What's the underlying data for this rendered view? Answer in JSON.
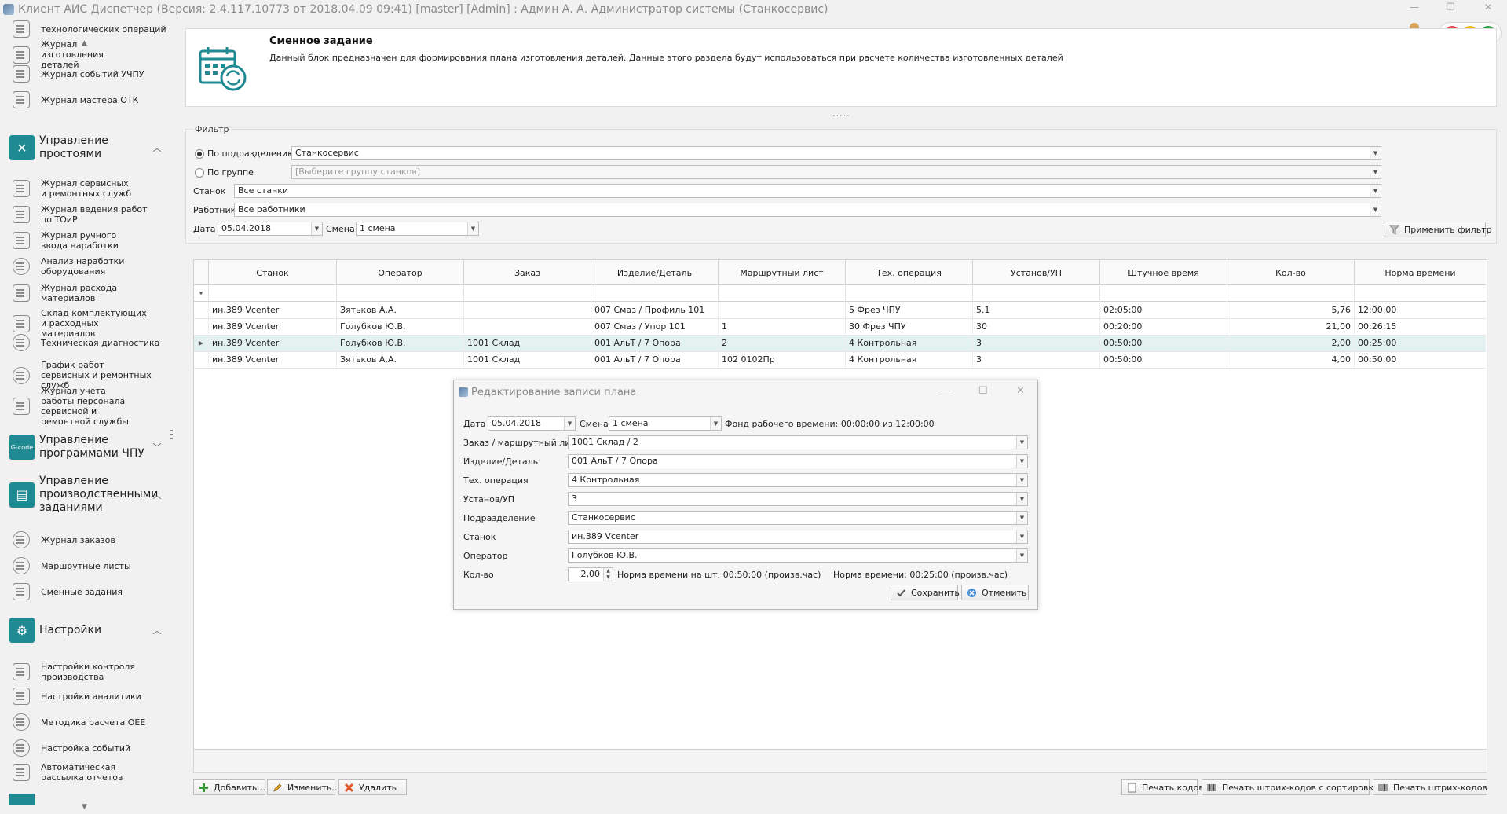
{
  "window": {
    "title": "Клиент АИС Диспетчер (Версия: 2.4.117.10773 от 2018.04.09 09:41) [master]  [Admin] : Админ А. А. Администратор системы (Станкосервис)"
  },
  "sidebar": {
    "items_top": [
      {
        "label": "технологических операций"
      },
      {
        "label": "Журнал изготовления деталей"
      },
      {
        "label": "Журнал событий УЧПУ"
      },
      {
        "label": "Журнал мастера ОТК"
      }
    ],
    "group_downtime": {
      "label": "Управление простоями"
    },
    "items_downtime": [
      {
        "label": "Журнал сервисных и ремонтных служб"
      },
      {
        "label": "Журнал ведения работ по ТОиР"
      },
      {
        "label": "Журнал ручного ввода наработки"
      },
      {
        "label": "Анализ наработки оборудования"
      },
      {
        "label": "Журнал расхода материалов"
      },
      {
        "label": "Склад комплектующих и расходных материалов"
      },
      {
        "label": "Техническая диагностика"
      },
      {
        "label": "График работ сервисных и ремонтных служб"
      },
      {
        "label": "Журнал учета работы персонала сервисной и ремонтной службы"
      }
    ],
    "group_cnc": {
      "label": "Управление программами ЧПУ",
      "icon_text": "G-code"
    },
    "group_production": {
      "label": "Управление производственными заданиями"
    },
    "items_production": [
      {
        "label": "Журнал заказов"
      },
      {
        "label": "Маршрутные листы"
      },
      {
        "label": "Сменные задания"
      }
    ],
    "group_settings": {
      "label": "Настройки"
    },
    "items_settings": [
      {
        "label": "Настройки контроля производства"
      },
      {
        "label": "Настройки аналитики"
      },
      {
        "label": "Методика расчета OEE"
      },
      {
        "label": "Настройка событий"
      },
      {
        "label": "Автоматическая рассылка отчетов"
      }
    ]
  },
  "header": {
    "title": "Сменное задание",
    "description": "Данный блок предназначен для формирования плана изготовления деталей. Данные этого раздела будут использоваться при расчете количества изготовленных деталей"
  },
  "filter": {
    "title": "Фильтр",
    "radio_department": "По подразделению",
    "department_value": "Станкосервис",
    "radio_group": "По группе",
    "group_placeholder": "[Выберите группу станков]",
    "machine_label": "Станок",
    "machine_value": "Все станки",
    "worker_label": "Работник",
    "worker_value": "Все работники",
    "date_label": "Дата",
    "date_value": "05.04.2018",
    "shift_label": "Смена",
    "shift_value": "1 смена",
    "apply_button": "Применить фильтр"
  },
  "grid": {
    "columns": [
      "Станок",
      "Оператор",
      "Заказ",
      "Изделие/Деталь",
      "Маршрутный лист",
      "Тех. операция",
      "Установ/УП",
      "Штучное время",
      "Кол-во",
      "Норма времени"
    ],
    "rows": [
      [
        "ин.389 Vcenter",
        "Зятьков А.А.",
        "",
        "007 Смаз / Профиль 101",
        "",
        "5 Фрез ЧПУ",
        "5.1",
        "02:05:00",
        "5,76",
        "12:00:00"
      ],
      [
        "ин.389 Vcenter",
        "Голубков Ю.В.",
        "",
        "007 Смаз / Упор 101",
        "1",
        "30 Фрез ЧПУ",
        "30",
        "00:20:00",
        "21,00",
        "00:26:15"
      ],
      [
        "ин.389 Vcenter",
        "Голубков Ю.В.",
        "1001 Склад",
        "001 АльТ / 7 Опора",
        "2",
        "4 Контрольная",
        "3",
        "00:50:00",
        "2,00",
        "00:25:00"
      ],
      [
        "ин.389 Vcenter",
        "Зятьков А.А.",
        "1001 Склад",
        "001 АльТ / 7 Опора",
        "102 0102Пр",
        "4 Контрольная",
        "3",
        "00:50:00",
        "4,00",
        "00:50:00"
      ]
    ],
    "selected_row": 2
  },
  "toolbar": {
    "add": "Добавить...",
    "edit": "Изменить...",
    "delete": "Удалить",
    "print_codes": "Печать кодов",
    "print_barcodes_sorted": "Печать штрих-кодов с сортировкой",
    "print_barcodes": "Печать штрих-кодов"
  },
  "dialog": {
    "title": "Редактирование записи плана",
    "date_label": "Дата",
    "date_value": "05.04.2018",
    "shift_label": "Смена",
    "shift_value": "1 смена",
    "fund_text": "Фонд рабочего времени: 00:00:00 из 12:00:00",
    "order_label": "Заказ / маршрутный лист",
    "order_value": "1001 Склад / 2",
    "part_label": "Изделие/Деталь",
    "part_value": "001 АльТ / 7 Опора",
    "operation_label": "Тех. операция",
    "operation_value": "4 Контрольная",
    "setup_label": "Установ/УП",
    "setup_value": "3",
    "department_label": "Подразделение",
    "department_value": "Станкосервис",
    "machine_label": "Станок",
    "machine_value": "ин.389 Vcenter",
    "operator_label": "Оператор",
    "operator_value": "Голубков Ю.В.",
    "qty_label": "Кол-во",
    "qty_value": "2,00",
    "norm_per_piece": "Норма времени на шт: 00:50:00 (произв.час)",
    "norm_total": "Норма времени: 00:25:00 (произв.час)",
    "save_button": "Сохранить",
    "cancel_button": "Отменить"
  },
  "colors": {
    "accent_teal": "#1f8a92",
    "selected_row": "#e3f1f1",
    "traffic_red": "#e5484d",
    "traffic_yellow": "#f2b705",
    "traffic_green": "#2ea043"
  }
}
